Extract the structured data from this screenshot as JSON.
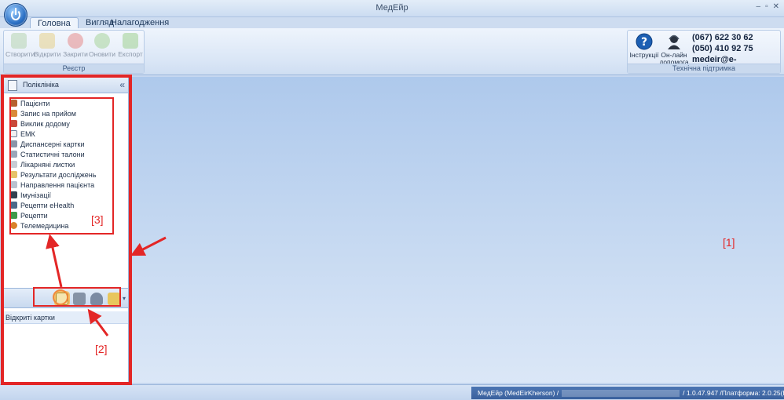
{
  "window": {
    "title": "МедЕйр",
    "controls": [
      "–",
      "▫",
      "✕"
    ]
  },
  "tabs": [
    "Головна",
    "Вигляд",
    "Налагодження"
  ],
  "ribbon": {
    "registry": {
      "buttons": [
        "Створити",
        "Відкрити",
        "Закрити",
        "Оновити",
        "Експорт"
      ],
      "label": "Реєстр"
    },
    "support": {
      "instructions": "Інструкції",
      "online_help_line1": "Он-лайн",
      "online_help_line2": "допомога",
      "phone1": "(067) 622 30 62",
      "phone2": "(050) 410 92 75",
      "email": "medeir@e-life.com.ua",
      "label": "Технічна підтримка"
    }
  },
  "panel": {
    "title": "Поліклініка",
    "collapse": "«",
    "items": [
      "Пацієнти",
      "Запис на прийом",
      "Виклик додому",
      "ЕМК",
      "Диспансерні картки",
      "Статистичні талони",
      "Лікарняні листки",
      "Результати досліджень",
      "Направлення пацієнта",
      "Імунізації",
      "Рецепти eHealth",
      "Рецепти",
      "Телемедицина"
    ],
    "open_cards": "Відкриті картки"
  },
  "status": {
    "left": "МедЕйр (MedEirKherson) /",
    "right": "/ 1.0.47.947 /Платформа: 2.0.25(hf7)"
  },
  "annotations": {
    "a1": "[1]",
    "a2": "[2]",
    "a3": "[3]"
  },
  "colors": {
    "annotation_red": "#e32626",
    "workspace": "#b9d0ef"
  }
}
